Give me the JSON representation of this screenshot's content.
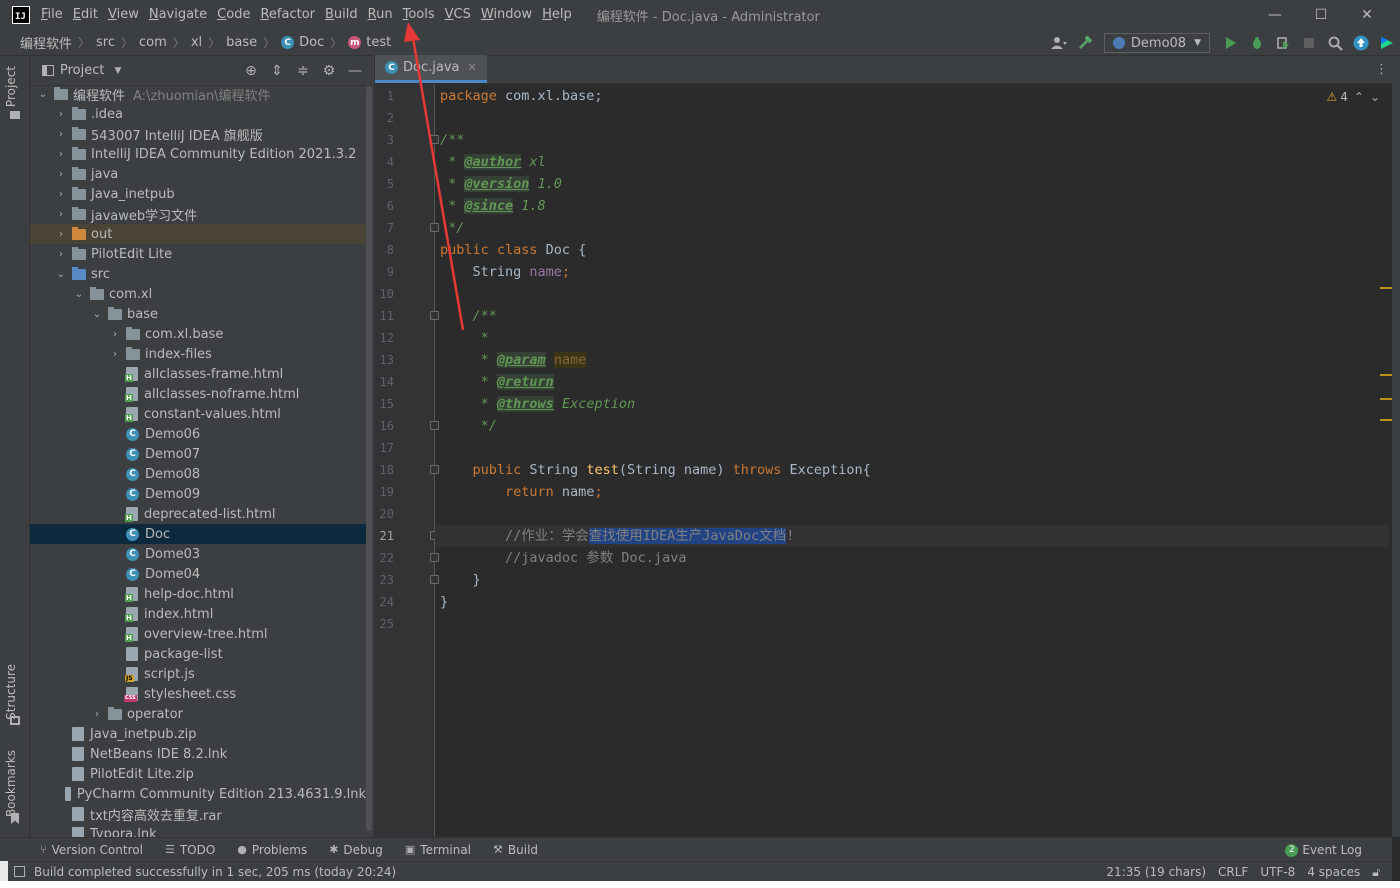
{
  "window": {
    "title": "编程软件 - Doc.java - Administrator",
    "controls": {
      "minimize": "—",
      "maximize": "☐",
      "close": "✕"
    }
  },
  "menu": [
    {
      "label": "File",
      "ul": "F",
      "rest": "ile"
    },
    {
      "label": "Edit",
      "ul": "E",
      "rest": "dit"
    },
    {
      "label": "View",
      "ul": "V",
      "rest": "iew"
    },
    {
      "label": "Navigate",
      "ul": "N",
      "rest": "avigate"
    },
    {
      "label": "Code",
      "ul": "C",
      "rest": "ode"
    },
    {
      "label": "Refactor",
      "ul": "R",
      "rest": "efactor"
    },
    {
      "label": "Build",
      "ul": "B",
      "rest": "uild"
    },
    {
      "label": "Run",
      "ul": "R",
      "rest": "un"
    },
    {
      "label": "Tools",
      "ul": "T",
      "rest": "ools"
    },
    {
      "label": "VCS",
      "ul": "V",
      "rest": "CS"
    },
    {
      "label": "Window",
      "ul": "W",
      "rest": "indow"
    },
    {
      "label": "Help",
      "ul": "H",
      "rest": "elp"
    }
  ],
  "breadcrumb": [
    "编程软件",
    "src",
    "com",
    "xl",
    "base",
    "Doc",
    "test"
  ],
  "run_config": "Demo08",
  "project_panel": {
    "title": "Project",
    "root_name": "编程软件",
    "root_path": "A:\\zhuomian\\编程软件"
  },
  "tree": [
    {
      "depth": 1,
      "arrow": "›",
      "icon": "folder",
      "label": ".idea"
    },
    {
      "depth": 1,
      "arrow": "›",
      "icon": "folder",
      "label": "543007 IntelliJ IDEA 旗舰版"
    },
    {
      "depth": 1,
      "arrow": "›",
      "icon": "folder",
      "label": "IntelliJ IDEA Community Edition 2021.3.2"
    },
    {
      "depth": 1,
      "arrow": "›",
      "icon": "folder",
      "label": "java"
    },
    {
      "depth": 1,
      "arrow": "›",
      "icon": "folder",
      "label": "Java_inetpub"
    },
    {
      "depth": 1,
      "arrow": "›",
      "icon": "folder",
      "label": "javaweb学习文件"
    },
    {
      "depth": 1,
      "arrow": "›",
      "icon": "folder-orange",
      "label": "out",
      "state": "excluded"
    },
    {
      "depth": 1,
      "arrow": "›",
      "icon": "folder",
      "label": "PilotEdit Lite"
    },
    {
      "depth": 1,
      "arrow": "⌄",
      "icon": "folder-blue",
      "label": "src"
    },
    {
      "depth": 2,
      "arrow": "⌄",
      "icon": "folder",
      "label": "com.xl"
    },
    {
      "depth": 3,
      "arrow": "⌄",
      "icon": "folder",
      "label": "base"
    },
    {
      "depth": 4,
      "arrow": "›",
      "icon": "folder",
      "label": "com.xl.base"
    },
    {
      "depth": 4,
      "arrow": "›",
      "icon": "folder",
      "label": "index-files"
    },
    {
      "depth": 4,
      "arrow": "",
      "icon": "html",
      "label": "allclasses-frame.html"
    },
    {
      "depth": 4,
      "arrow": "",
      "icon": "html",
      "label": "allclasses-noframe.html"
    },
    {
      "depth": 4,
      "arrow": "",
      "icon": "html",
      "label": "constant-values.html"
    },
    {
      "depth": 4,
      "arrow": "",
      "icon": "class",
      "label": "Demo06"
    },
    {
      "depth": 4,
      "arrow": "",
      "icon": "class",
      "label": "Demo07"
    },
    {
      "depth": 4,
      "arrow": "",
      "icon": "class",
      "label": "Demo08"
    },
    {
      "depth": 4,
      "arrow": "",
      "icon": "class",
      "label": "Demo09"
    },
    {
      "depth": 4,
      "arrow": "",
      "icon": "html",
      "label": "deprecated-list.html"
    },
    {
      "depth": 4,
      "arrow": "",
      "icon": "class",
      "label": "Doc",
      "state": "selected"
    },
    {
      "depth": 4,
      "arrow": "",
      "icon": "class",
      "label": "Dome03"
    },
    {
      "depth": 4,
      "arrow": "",
      "icon": "class",
      "label": "Dome04"
    },
    {
      "depth": 4,
      "arrow": "",
      "icon": "html",
      "label": "help-doc.html"
    },
    {
      "depth": 4,
      "arrow": "",
      "icon": "html",
      "label": "index.html"
    },
    {
      "depth": 4,
      "arrow": "",
      "icon": "html",
      "label": "overview-tree.html"
    },
    {
      "depth": 4,
      "arrow": "",
      "icon": "file",
      "label": "package-list"
    },
    {
      "depth": 4,
      "arrow": "",
      "icon": "js",
      "label": "script.js"
    },
    {
      "depth": 4,
      "arrow": "",
      "icon": "css",
      "label": "stylesheet.css"
    },
    {
      "depth": 3,
      "arrow": "›",
      "icon": "folder",
      "label": "operator"
    },
    {
      "depth": 1,
      "arrow": "",
      "icon": "zip",
      "label": "Java_inetpub.zip"
    },
    {
      "depth": 1,
      "arrow": "",
      "icon": "lnk",
      "label": "NetBeans IDE 8.2.lnk"
    },
    {
      "depth": 1,
      "arrow": "",
      "icon": "zip",
      "label": "PilotEdit Lite.zip"
    },
    {
      "depth": 1,
      "arrow": "",
      "icon": "lnk",
      "label": "PyCharm Community Edition 213.4631.9.lnk"
    },
    {
      "depth": 1,
      "arrow": "",
      "icon": "file",
      "label": "txt内容高效去重复.rar"
    },
    {
      "depth": 1,
      "arrow": "",
      "icon": "lnk",
      "label": "Typora.lnk"
    }
  ],
  "editor": {
    "tab_label": "Doc.java",
    "current_line": 21,
    "inspection_count": "4",
    "lines": [
      [
        [
          "kw",
          "package "
        ],
        [
          "pl",
          "com.xl.base;"
        ]
      ],
      [],
      [
        [
          "cm",
          "/**"
        ]
      ],
      [
        [
          "cm",
          " * "
        ],
        [
          "tag",
          "@author"
        ],
        [
          "cm",
          " xl"
        ]
      ],
      [
        [
          "cm",
          " * "
        ],
        [
          "tag",
          "@version"
        ],
        [
          "cm",
          " 1.0"
        ]
      ],
      [
        [
          "cm",
          " * "
        ],
        [
          "tag",
          "@since"
        ],
        [
          "cm",
          " 1.8"
        ]
      ],
      [
        [
          "cm",
          " */"
        ]
      ],
      [
        [
          "kw",
          "public class "
        ],
        [
          "pl",
          "Doc {"
        ]
      ],
      [
        [
          "pl",
          "    String "
        ],
        [
          "fld",
          "name"
        ],
        [
          "kw",
          ";"
        ]
      ],
      [],
      [
        [
          "cm",
          "    /**"
        ]
      ],
      [
        [
          "cm",
          "     *"
        ]
      ],
      [
        [
          "cm",
          "     * "
        ],
        [
          "tag",
          "@param"
        ],
        [
          "cm",
          " "
        ],
        [
          "nm",
          "name"
        ]
      ],
      [
        [
          "cm",
          "     * "
        ],
        [
          "tag",
          "@return"
        ]
      ],
      [
        [
          "cm",
          "     * "
        ],
        [
          "tag",
          "@throws"
        ],
        [
          "cm",
          " "
        ],
        [
          "cmx",
          "Exception"
        ]
      ],
      [
        [
          "cm",
          "     */"
        ]
      ],
      [],
      [
        [
          "kw",
          "    public "
        ],
        [
          "pl",
          "String "
        ],
        [
          "fn",
          "test"
        ],
        [
          "pl",
          "(String name) "
        ],
        [
          "kw",
          "throws "
        ],
        [
          "pl",
          "Exception{"
        ]
      ],
      [
        [
          "kw",
          "        return "
        ],
        [
          "pl",
          "name"
        ],
        [
          "kw",
          ";"
        ]
      ],
      [],
      [
        [
          "lc",
          "        //作业："
        ],
        [
          "lc",
          "学会"
        ],
        [
          "sel",
          "查找使用IDEA生产JavaDoc文档"
        ],
        [
          "lc",
          "!"
        ]
      ],
      [
        [
          "lc",
          "        //javadoc 参数 Doc.java"
        ]
      ],
      [
        [
          "pl",
          "    }"
        ]
      ],
      [
        [
          "pl",
          "}"
        ]
      ],
      []
    ]
  },
  "bottom_tools": [
    {
      "icon": "⑂",
      "label": "Version Control"
    },
    {
      "icon": "☰",
      "label": "TODO"
    },
    {
      "icon": "●",
      "label": "Problems"
    },
    {
      "icon": "✱",
      "label": "Debug"
    },
    {
      "icon": "▣",
      "label": "Terminal"
    },
    {
      "icon": "⚒",
      "label": "Build"
    }
  ],
  "event_log": {
    "count": "2",
    "label": "Event Log"
  },
  "status": {
    "message": "Build completed successfully in 1 sec, 205 ms (today 20:24)",
    "position": "21:35 (19 chars)",
    "line_sep": "CRLF",
    "encoding": "UTF-8",
    "indent": "4 spaces"
  },
  "side_tabs": {
    "project": "Project",
    "structure": "Structure",
    "bookmarks": "Bookmarks"
  },
  "colors": {
    "accent": "#4a88c7",
    "annotation": "#e53935",
    "selection": "#214283"
  }
}
